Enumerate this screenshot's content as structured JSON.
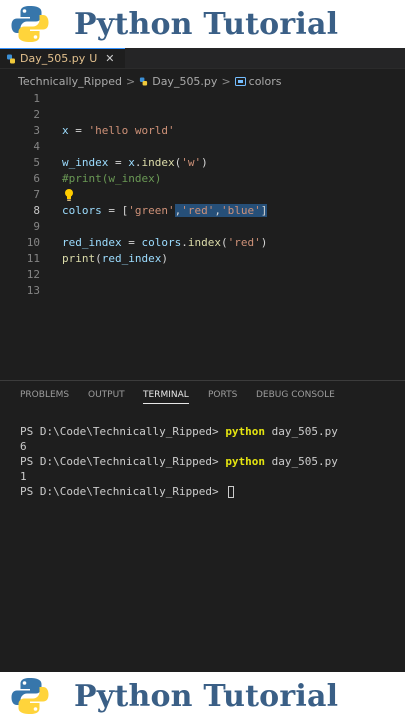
{
  "banner": {
    "title": "Python Tutorial"
  },
  "tab": {
    "filename": "Day_505.py",
    "modified_marker": "U",
    "close_glyph": "✕"
  },
  "breadcrumb": {
    "folder": "Technically_Ripped",
    "sep": ">",
    "file": "Day_505.py",
    "symbol": "colors"
  },
  "editor": {
    "line_numbers": [
      "1",
      "2",
      "3",
      "4",
      "5",
      "6",
      "7",
      "8",
      "9",
      "10",
      "11",
      "12",
      "13"
    ],
    "line3": {
      "a": "x",
      "b": " = ",
      "c": "'hello world'"
    },
    "line5": {
      "a": "w_index",
      "b": " = ",
      "c": "x",
      "d": ".",
      "e": "index",
      "f": "(",
      "g": "'w'",
      "h": ")"
    },
    "line6": {
      "a": "#print(w_index)"
    },
    "line8": {
      "a": "colors",
      "b": " = [",
      "c": "'green'",
      "d": ",",
      "e": "'red'",
      "f": ",",
      "g": "'blue'",
      "h": "]"
    },
    "line10": {
      "a": "red_index",
      "b": " = ",
      "c": "colors",
      "d": ".",
      "e": "index",
      "f": "(",
      "g": "'red'",
      "h": ")"
    },
    "line11": {
      "a": "print",
      "b": "(",
      "c": "red_index",
      "d": ")"
    }
  },
  "panel": {
    "tabs": [
      "PROBLEMS",
      "OUTPUT",
      "TERMINAL",
      "PORTS",
      "DEBUG CONSOLE"
    ],
    "active_tab": "TERMINAL"
  },
  "terminal": {
    "prompt": "PS D:\\Code\\Technically_Ripped> ",
    "cmd1": "python",
    "args1": " day_505.py",
    "out1": "6",
    "cmd2": "python",
    "args2": " day_505.py",
    "out2": "1"
  },
  "colors": {
    "accent": "#3794ff",
    "banner_text": "#3a5f86",
    "editor_bg": "#1e1e1e",
    "selection": "#264f78"
  },
  "icons": [
    "python-logo-icon",
    "python-file-icon",
    "close-icon",
    "chevron-right-icon",
    "symbol-variable-icon",
    "lightbulb-icon"
  ]
}
